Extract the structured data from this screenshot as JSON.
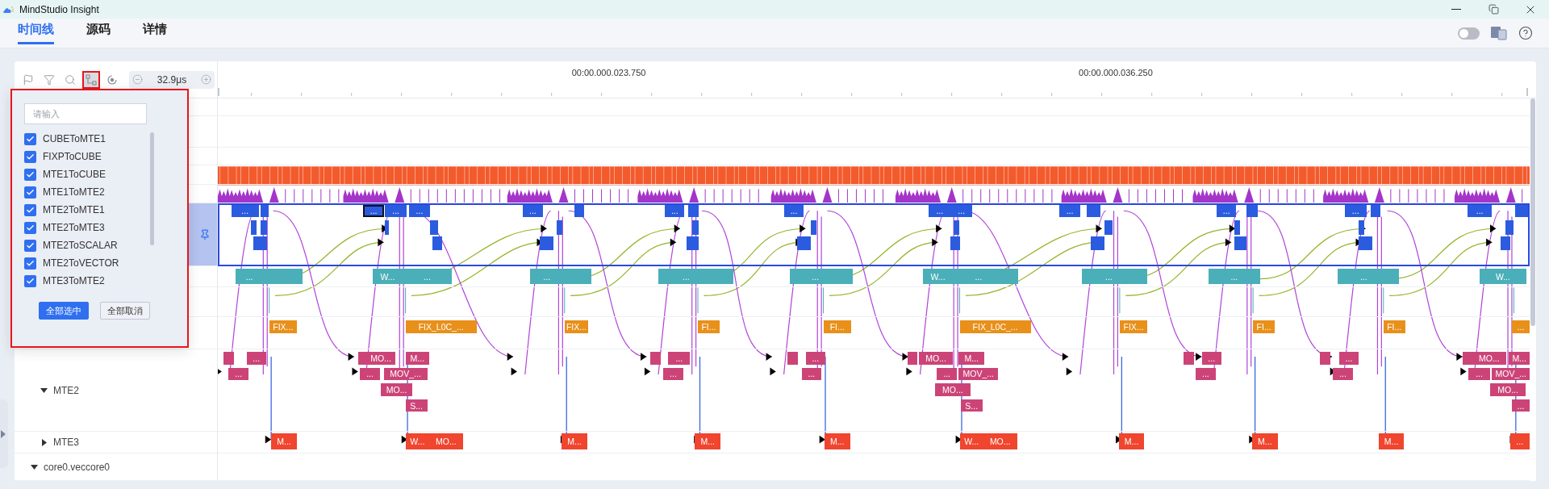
{
  "window": {
    "title": "MindStudio Insight"
  },
  "tabs": [
    {
      "label": "时间线",
      "selected": true
    },
    {
      "label": "源码",
      "selected": false
    },
    {
      "label": "详情",
      "selected": false
    }
  ],
  "theme_toggle": {
    "on": false
  },
  "toolbar": {
    "tools": [
      {
        "kind": "flag",
        "selected": false
      },
      {
        "kind": "filter",
        "selected": false
      },
      {
        "kind": "search",
        "selected": false
      },
      {
        "kind": "flow",
        "selected": true
      },
      {
        "kind": "locate",
        "selected": false
      }
    ],
    "zoom_value": "32.9μs"
  },
  "ruler": {
    "labels": [
      "00:00.000.023.750",
      "00:00.000.036.250"
    ]
  },
  "tree": [
    {
      "children": [
        {
          "label": "MTE2",
          "expanded": true
        },
        {
          "label": "MTE3",
          "expanded": false
        }
      ]
    },
    {
      "label": "core0.veccore0",
      "expanded": true
    }
  ],
  "flow_filter": {
    "search": {
      "placeholder": "请输入"
    },
    "categories": [
      {
        "label": "CUBEToMTE1",
        "checked": true
      },
      {
        "label": "FIXPToCUBE",
        "checked": true
      },
      {
        "label": "MTE1ToCUBE",
        "checked": true
      },
      {
        "label": "MTE1ToMTE2",
        "checked": true
      },
      {
        "label": "MTE2ToMTE1",
        "checked": true
      },
      {
        "label": "MTE2ToMTE3",
        "checked": true
      },
      {
        "label": "MTE2ToSCALAR",
        "checked": true
      },
      {
        "label": "MTE2ToVECTOR",
        "checked": true
      },
      {
        "label": "MTE3ToMTE2",
        "checked": true
      }
    ],
    "buttons": [
      {
        "label": "全部选中",
        "kind": "primary"
      },
      {
        "label": "全部取消",
        "kind": "secondary"
      }
    ]
  },
  "tracks": [
    {
      "color": "#2b5ce0",
      "selected": true,
      "slices": [
        {
          "label": "...",
          "selected": false
        },
        {
          "label": "...",
          "selected": true
        },
        {
          "label": "...",
          "selected": false
        },
        {
          "label": "...",
          "selected": false
        },
        {
          "label": "...",
          "selected": false
        },
        {
          "label": "...",
          "selected": false
        },
        {
          "label": "...",
          "selected": false
        },
        {
          "label": "...",
          "selected": false
        },
        {
          "label": "...",
          "selected": false
        },
        {
          "label": "...",
          "selected": false
        },
        {
          "label": "...",
          "selected": false
        },
        {
          "label": "...",
          "selected": false
        },
        {
          "label": "...",
          "selected": false
        }
      ]
    },
    {
      "color": "#4aafb8",
      "selected": false,
      "slices": [
        {
          "label": "...",
          "selected": false
        },
        {
          "label": "W...",
          "selected": false
        },
        {
          "label": "...",
          "selected": false
        },
        {
          "label": "...",
          "selected": false
        },
        {
          "label": "...",
          "selected": false
        },
        {
          "label": "...",
          "selected": false
        },
        {
          "label": "W...",
          "selected": false
        },
        {
          "label": "...",
          "selected": false
        },
        {
          "label": "...",
          "selected": false
        },
        {
          "label": "...",
          "selected": false
        },
        {
          "label": "...",
          "selected": false
        },
        {
          "label": "W...",
          "selected": false
        }
      ]
    },
    {
      "color": "#e8901a",
      "selected": false,
      "slices": [
        {
          "label": "FIX...",
          "selected": false
        },
        {
          "label": "FIX_L0C_...",
          "selected": false
        },
        {
          "label": "FIX...",
          "selected": false
        },
        {
          "label": "FI...",
          "selected": false
        },
        {
          "label": "FI...",
          "selected": false
        },
        {
          "label": "FIX_L0C_...",
          "selected": false
        },
        {
          "label": "FIX...",
          "selected": false
        },
        {
          "label": "FI...",
          "selected": false
        },
        {
          "label": "FI...",
          "selected": false
        },
        {
          "label": "...",
          "selected": false
        }
      ]
    },
    {
      "color": "#cc4477",
      "selected": false,
      "slices": [
        {
          "label": "...",
          "selected": false
        },
        {
          "label": "MO...",
          "selected": false
        },
        {
          "label": "M...",
          "selected": false
        },
        {
          "label": "...",
          "selected": false
        },
        {
          "label": "...",
          "selected": false
        },
        {
          "label": "MO...",
          "selected": false
        },
        {
          "label": "M...",
          "selected": false
        },
        {
          "label": "...",
          "selected": false
        },
        {
          "label": "...",
          "selected": false
        },
        {
          "label": "MO...",
          "selected": false
        },
        {
          "label": "M...",
          "selected": false
        },
        {
          "label": "...",
          "selected": false
        },
        {
          "label": "...",
          "selected": false
        },
        {
          "label": "MOV_...",
          "selected": false
        },
        {
          "label": "...",
          "selected": false
        },
        {
          "label": "...",
          "selected": false
        },
        {
          "label": "...",
          "selected": false
        },
        {
          "label": "MOV_...",
          "selected": false
        },
        {
          "label": "...",
          "selected": false
        },
        {
          "label": "...",
          "selected": false
        },
        {
          "label": "...",
          "selected": false
        },
        {
          "label": "MOV_...",
          "selected": false
        },
        {
          "label": "MO...",
          "selected": false
        },
        {
          "label": "MO...",
          "selected": false
        },
        {
          "label": "MO...",
          "selected": false
        },
        {
          "label": "S...",
          "selected": false
        },
        {
          "label": "S...",
          "selected": false
        },
        {
          "label": "...",
          "selected": false
        }
      ]
    },
    {
      "color": "#f0452e",
      "selected": false,
      "slices": [
        {
          "label": "M...",
          "selected": false
        },
        {
          "label": "W...",
          "selected": false
        },
        {
          "label": "MO...",
          "selected": false
        },
        {
          "label": "M...",
          "selected": false
        },
        {
          "label": "M...",
          "selected": false
        },
        {
          "label": "M...",
          "selected": false
        },
        {
          "label": "W...",
          "selected": false
        },
        {
          "label": "MO...",
          "selected": false
        },
        {
          "label": "M...",
          "selected": false
        },
        {
          "label": "M...",
          "selected": false
        },
        {
          "label": "M...",
          "selected": false
        },
        {
          "label": "...",
          "selected": false
        }
      ]
    }
  ]
}
